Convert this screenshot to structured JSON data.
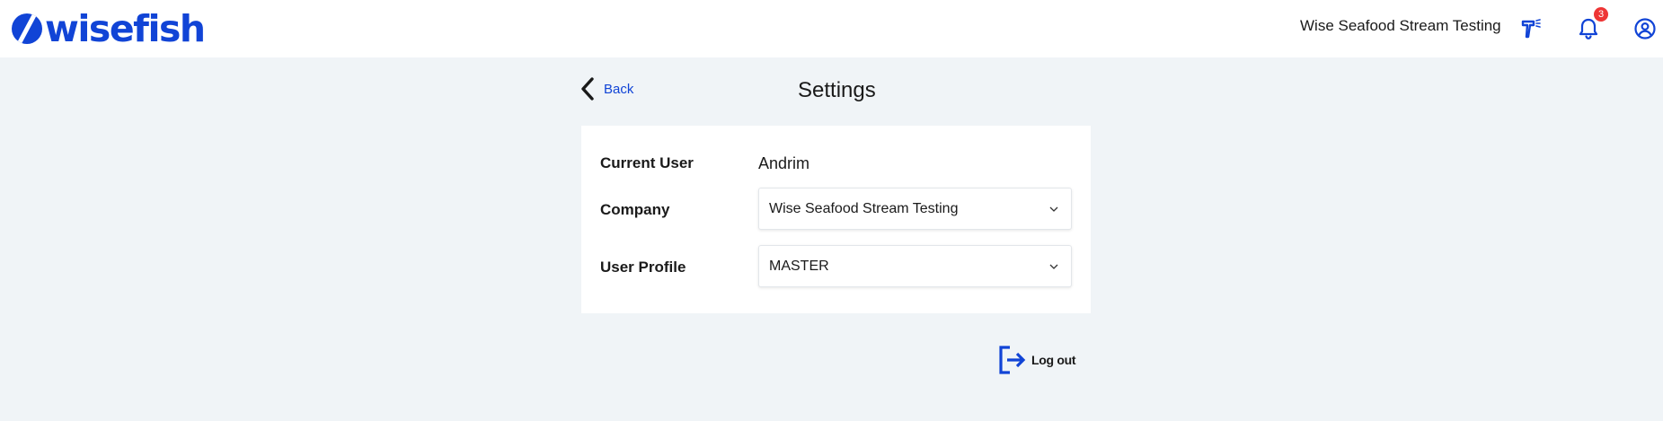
{
  "header": {
    "logo_text": "wisefish",
    "company_name": "Wise Seafood Stream Testing",
    "notification_count": "3"
  },
  "page": {
    "back_label": "Back",
    "title": "Settings"
  },
  "settings": {
    "current_user_label": "Current User",
    "current_user_value": "Andrim",
    "company_label": "Company",
    "company_value": "Wise Seafood Stream Testing",
    "profile_label": "User Profile",
    "profile_value": "MASTER"
  },
  "logout": {
    "label": "Log out"
  },
  "colors": {
    "brand": "#1144d6",
    "background": "#f0f4f7",
    "badge": "#ee3535"
  },
  "icons": {
    "logo": "wisefish-logo-icon",
    "brush": "brush-icon",
    "bell": "bell-icon",
    "user": "user-circle-icon",
    "back": "chevron-left-icon",
    "dropdown": "chevron-down-icon",
    "logout": "logout-icon"
  }
}
